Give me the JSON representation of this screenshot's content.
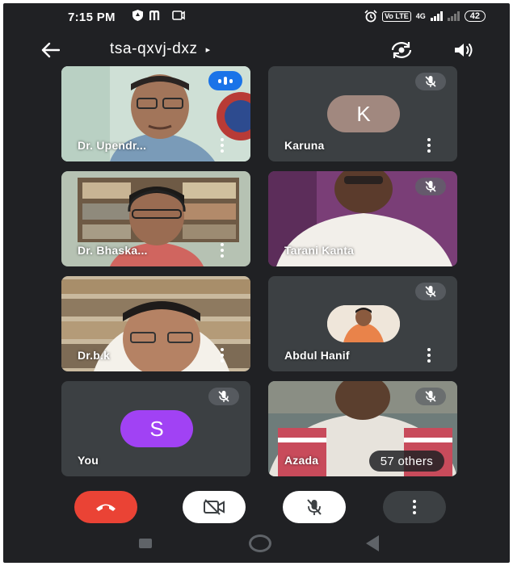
{
  "status_bar": {
    "time": "7:15 PM",
    "left_icons": [
      "shield-icon",
      "m-icon",
      "cast-icon"
    ],
    "alarm_icon": "alarm-icon",
    "volte_label": "Vo LTE",
    "network_label": "4G",
    "battery": "42"
  },
  "header": {
    "meeting_code": "tsa-qxvj-dxz",
    "caret": "▸"
  },
  "participants": [
    {
      "name": "Dr. Upendr...",
      "state": "speaking",
      "video": true
    },
    {
      "name": "Karuna",
      "state": "muted",
      "video": false,
      "avatar_letter": "K",
      "avatar_color": "#a1887f"
    },
    {
      "name": "Dr. Bhaska...",
      "state": "unmuted",
      "video": true
    },
    {
      "name": "Tarani Kanta",
      "state": "muted",
      "video": true
    },
    {
      "name": "Dr.b.k",
      "state": "unmuted",
      "video": true
    },
    {
      "name": "Abdul Hanif",
      "state": "muted",
      "video": false,
      "avatar": "photo"
    },
    {
      "name": "You",
      "state": "muted",
      "video": false,
      "avatar_letter": "S",
      "avatar_color": "#a142f4"
    },
    {
      "name": "Azada",
      "state": "muted",
      "video": true
    }
  ],
  "others_chip": "57 others",
  "colors": {
    "background": "#202124",
    "tile": "#3c4043",
    "end_call": "#ea4335",
    "speaking": "#1a73e8"
  }
}
